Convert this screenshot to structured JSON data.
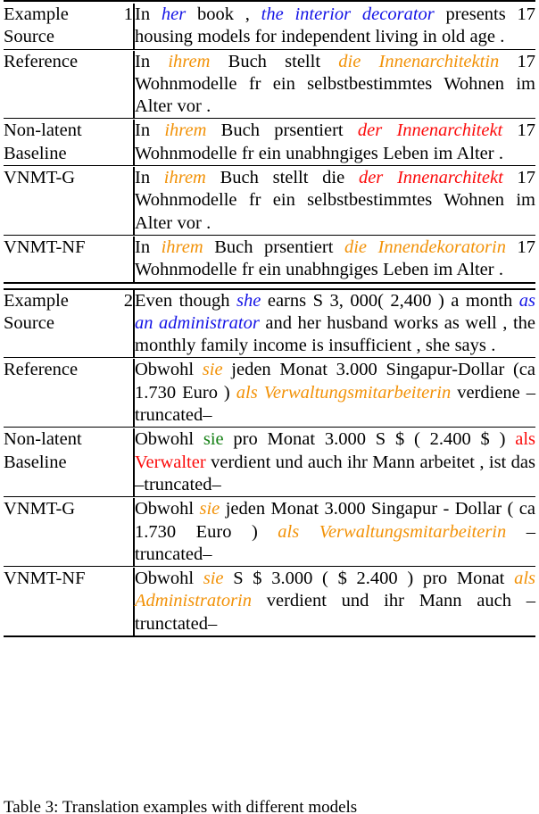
{
  "table": {
    "caption": "Table 3:  Translation examples with different models",
    "colors": {
      "source_highlight": "#1414E6",
      "correct_highlight": "#F29208",
      "correct_upright": "#158015",
      "incorrect_highlight": "#FB0B0B"
    },
    "groups": [
      {
        "id": "example-1",
        "rows": [
          {
            "label": "Example 1 Source",
            "label_line1": "Example",
            "label_line2": "1",
            "label_line3": "Source",
            "justify_label": true,
            "segments": [
              {
                "text": "In ",
                "style": "plain"
              },
              {
                "text": "her",
                "style": "source"
              },
              {
                "text": " book , ",
                "style": "plain"
              },
              {
                "text": "the interior decorator",
                "style": "source"
              },
              {
                "text": " presents 17 housing models for independent living in old age .",
                "style": "plain"
              }
            ]
          },
          {
            "label": "Reference",
            "label_line1": "Reference",
            "justify_label": false,
            "segments": [
              {
                "text": "In ",
                "style": "plain"
              },
              {
                "text": "ihrem",
                "style": "correct"
              },
              {
                "text": " Buch stellt ",
                "style": "plain"
              },
              {
                "text": "die Innenarchitektin",
                "style": "correct"
              },
              {
                "text": " 17 Wohnmodelle fr ein selbstbestimmtes Wohnen im Alter vor .",
                "style": "plain"
              }
            ]
          },
          {
            "label": "Non-latent Baseline",
            "label_line1": "Non-latent",
            "label_line2": "Baseline",
            "justify_label": false,
            "segments": [
              {
                "text": "In ",
                "style": "plain"
              },
              {
                "text": "ihrem",
                "style": "correct"
              },
              {
                "text": " Buch prsentiert ",
                "style": "plain"
              },
              {
                "text": "der Innenarchitekt",
                "style": "incorrect"
              },
              {
                "text": " 17 Wohnmodelle fr ein unabhngiges Leben im Alter .",
                "style": "plain"
              }
            ]
          },
          {
            "label": "VNMT-G",
            "label_line1": "VNMT-G",
            "justify_label": false,
            "segments": [
              {
                "text": "In ",
                "style": "plain"
              },
              {
                "text": "ihrem",
                "style": "correct"
              },
              {
                "text": " Buch stellt die ",
                "style": "plain"
              },
              {
                "text": "der Innenarchitekt",
                "style": "incorrect"
              },
              {
                "text": " 17 Wohnmodelle fr ein selbstbestimmtes Wohnen im Alter vor .",
                "style": "plain"
              }
            ]
          },
          {
            "label": "VNMT-NF",
            "label_line1": "VNMT-NF",
            "justify_label": false,
            "segments": [
              {
                "text": "In ",
                "style": "plain"
              },
              {
                "text": "ihrem",
                "style": "correct"
              },
              {
                "text": " Buch prsentiert ",
                "style": "plain"
              },
              {
                "text": "die Innendekoratorin",
                "style": "correct"
              },
              {
                "text": " 17 Wohnmodelle fr ein unabhngiges Leben im Alter .",
                "style": "plain"
              }
            ]
          }
        ]
      },
      {
        "id": "example-2",
        "rows": [
          {
            "label": "Example 2 Source",
            "label_line1": "Example",
            "label_line2": "2",
            "label_line3": "Source",
            "justify_label": true,
            "segments": [
              {
                "text": "Even though ",
                "style": "plain"
              },
              {
                "text": "she",
                "style": "source"
              },
              {
                "text": " earns S 3, 000( 2,400 ) a month ",
                "style": "plain"
              },
              {
                "text": "as an administrator",
                "style": "source"
              },
              {
                "text": " and her husband works as well , the monthly family income is insufficient , she says .",
                "style": "plain"
              }
            ]
          },
          {
            "label": "Reference",
            "label_line1": "Reference",
            "justify_label": false,
            "segments": [
              {
                "text": "Obwohl ",
                "style": "plain"
              },
              {
                "text": "sie",
                "style": "correct"
              },
              {
                "text": " jeden Monat 3.000 Singapur-Dollar (ca 1.730 Euro ) ",
                "style": "plain"
              },
              {
                "text": "als Verwaltungsmitarbeiterin",
                "style": "correct"
              },
              {
                "text": " verdiene –truncated–",
                "style": "plain"
              }
            ]
          },
          {
            "label": "Non-latent Baseline",
            "label_line1": "Non-latent",
            "label_line2": "Baseline",
            "justify_label": false,
            "segments": [
              {
                "text": "Obwohl ",
                "style": "plain"
              },
              {
                "text": "sie",
                "style": "correct-upright"
              },
              {
                "text": " pro Monat 3.000 S $ ( 2.400 $ ) ",
                "style": "plain"
              },
              {
                "text": "als Verwalter",
                "style": "incorrect-upright"
              },
              {
                "text": " verdient und auch ihr Mann arbeitet , ist das –truncated–",
                "style": "plain"
              }
            ]
          },
          {
            "label": "VNMT-G",
            "label_line1": "VNMT-G",
            "justify_label": false,
            "segments": [
              {
                "text": "Obwohl ",
                "style": "plain"
              },
              {
                "text": "sie",
                "style": "correct"
              },
              {
                "text": " jeden Monat 3.000 Singapur - Dollar ( ca 1.730 Euro ) ",
                "style": "plain"
              },
              {
                "text": "als Verwaltungsmitarbeiterin",
                "style": "correct"
              },
              {
                "text": " –truncated–",
                "style": "plain"
              }
            ]
          },
          {
            "label": "VNMT-NF",
            "label_line1": "VNMT-NF",
            "justify_label": false,
            "segments": [
              {
                "text": "Obwohl ",
                "style": "plain"
              },
              {
                "text": "sie",
                "style": "correct"
              },
              {
                "text": " S $ 3.000 ( $ 2.400 ) pro Monat ",
                "style": "plain"
              },
              {
                "text": "als Administratorin",
                "style": "correct"
              },
              {
                "text": " verdient und ihr Mann auch –trunctated–",
                "style": "plain"
              }
            ]
          }
        ]
      }
    ]
  }
}
